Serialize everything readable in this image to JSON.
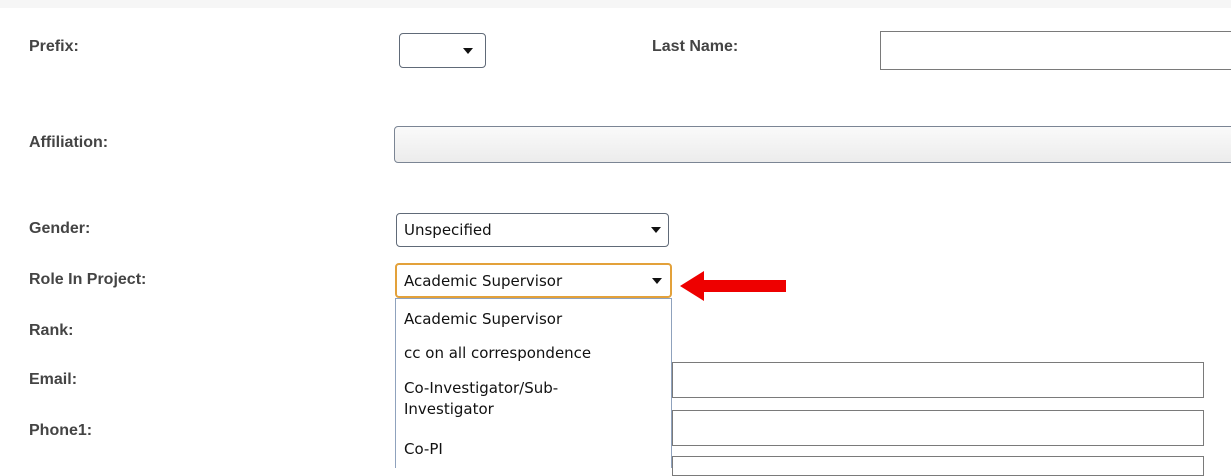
{
  "form": {
    "prefix": {
      "label": "Prefix:",
      "value": ""
    },
    "last_name": {
      "label": "Last Name:",
      "value": ""
    },
    "affiliation": {
      "label": "Affiliation:",
      "value": ""
    },
    "gender": {
      "label": "Gender:",
      "value": "Unspecified"
    },
    "role": {
      "label": "Role In Project:",
      "value": "Academic Supervisor",
      "options": [
        "Academic Supervisor",
        "cc on all correspondence",
        "Co-Investigator/Sub-Investigator",
        "Co-PI"
      ]
    },
    "rank": {
      "label": "Rank:"
    },
    "email": {
      "label": "Email:",
      "value": ""
    },
    "phone1": {
      "label": "Phone1:",
      "value": ""
    }
  },
  "annotation": {
    "arrow_color": "#ee0000",
    "points_to": "role-in-project-select"
  },
  "icons": [
    "chevron-down-icon",
    "red-arrow-icon"
  ]
}
